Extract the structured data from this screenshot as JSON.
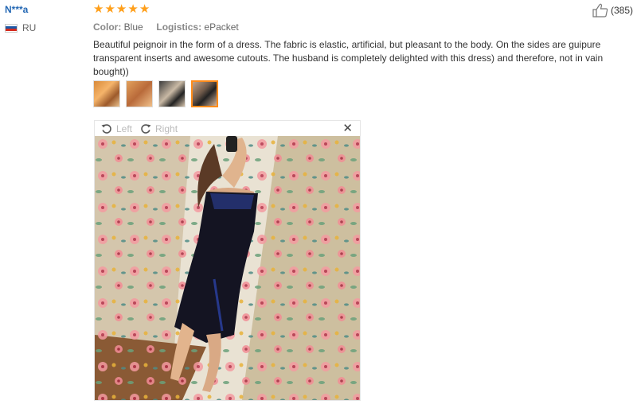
{
  "reviewer": {
    "name": "N***a",
    "country": "RU",
    "flag_colors": [
      "#ffffff",
      "#1c57a5",
      "#d52b1e"
    ]
  },
  "rating": {
    "stars": 5,
    "max": 5,
    "color": "#ff9f1a"
  },
  "meta": {
    "color_label": "Color:",
    "color_value": "Blue",
    "logistics_label": "Logistics:",
    "logistics_value": "ePacket"
  },
  "review_text": "Beautiful peignoir in the form of a dress. The fabric is elastic, artificial, but pleasant to the body. On the sides are guipure transparent inserts and awesome cutouts. The husband is completely delighted with this dress) and therefore, not in vain bought))",
  "helpful": {
    "icon": "thumbs-up-icon",
    "count": "(385)"
  },
  "thumbnails": {
    "count": 4,
    "active_index": 3,
    "accent": "#ff8c1a"
  },
  "viewer": {
    "rotate_left_label": "Left",
    "rotate_right_label": "Right",
    "close_icon": "close-icon"
  }
}
